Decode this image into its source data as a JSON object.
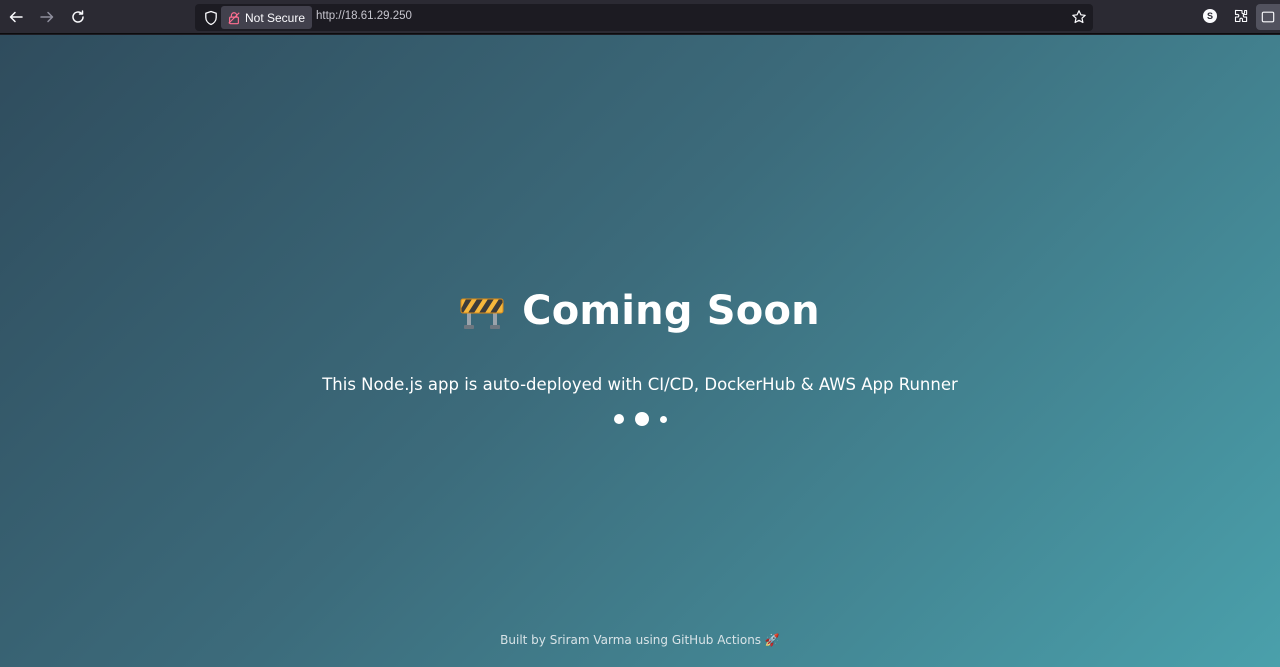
{
  "browser": {
    "security_label": "Not Secure",
    "url": "http://18.61.29.250",
    "icons": [
      "back-icon",
      "forward-icon",
      "reload-icon",
      "shield-icon",
      "lock-warning-icon",
      "star-icon",
      "s-extension-icon",
      "extensions-icon",
      "sidebar-icon"
    ]
  },
  "page": {
    "emoji": "construction-barrier-icon",
    "title": "Coming Soon",
    "subtitle": "This Node.js app is auto-deployed with CI/CD, DockerHub & AWS App Runner",
    "footer": "Built by Sriram Varma using GitHub Actions 🚀",
    "loader_dot_count": 3,
    "colors": {
      "gradient_start": "#2f4c5d",
      "gradient_end": "#4aa0ab",
      "text": "#ffffff"
    }
  }
}
